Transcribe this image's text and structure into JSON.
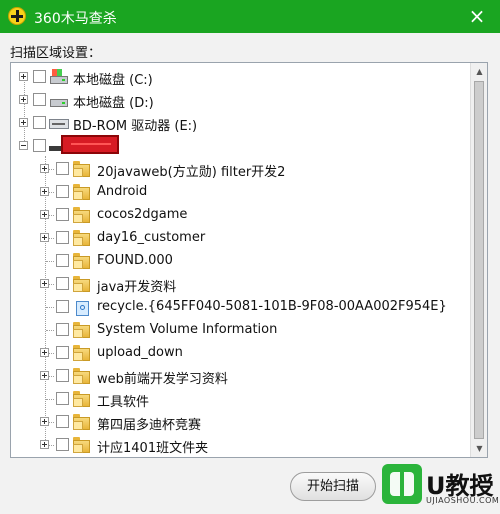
{
  "window": {
    "title": "360木马查杀",
    "logo_icon": "360-logo-icon",
    "close_label": "×",
    "accent_color": "#1aa521"
  },
  "scan_area": {
    "label": "扫描区域设置："
  },
  "tree": {
    "drives": [
      {
        "label": "本地磁盘 (C:)",
        "icon": "hard-disk-icon",
        "expanded": false
      },
      {
        "label": "本地磁盘 (D:)",
        "icon": "hard-disk-icon",
        "expanded": false
      },
      {
        "label": "BD-ROM 驱动器 (E:)",
        "icon": "optical-drive-icon",
        "expanded": false
      },
      {
        "label": "",
        "icon": "removable-drive-icon",
        "expanded": true
      }
    ],
    "children": [
      {
        "label": "20javaweb(方立勋) filter开发2",
        "icon": "folder-icon",
        "has_children": true
      },
      {
        "label": "Android",
        "icon": "folder-icon",
        "has_children": true
      },
      {
        "label": "cocos2dgame",
        "icon": "folder-icon",
        "has_children": true
      },
      {
        "label": "day16_customer",
        "icon": "folder-icon",
        "has_children": true
      },
      {
        "label": "FOUND.000",
        "icon": "folder-icon",
        "has_children": false
      },
      {
        "label": "java开发资料",
        "icon": "folder-icon",
        "has_children": true
      },
      {
        "label": "recycle.{645FF040-5081-101B-9F08-00AA002F954E}",
        "icon": "recycle-bin-icon",
        "has_children": false
      },
      {
        "label": "System Volume Information",
        "icon": "folder-icon",
        "has_children": false
      },
      {
        "label": "upload_down",
        "icon": "folder-icon",
        "has_children": true
      },
      {
        "label": "web前端开发学习资料",
        "icon": "folder-icon",
        "has_children": true
      },
      {
        "label": "工具软件",
        "icon": "folder-icon",
        "has_children": false
      },
      {
        "label": "第四届多迪杯竞赛",
        "icon": "folder-icon",
        "has_children": true
      },
      {
        "label": "计应1401班文件夹",
        "icon": "folder-icon",
        "has_children": true
      }
    ]
  },
  "footer": {
    "start_button_label": "开始扫描"
  },
  "watermark": {
    "text": "U教授",
    "site": "UJIAOSHOU.COM",
    "brand_color": "#2bb43b"
  }
}
